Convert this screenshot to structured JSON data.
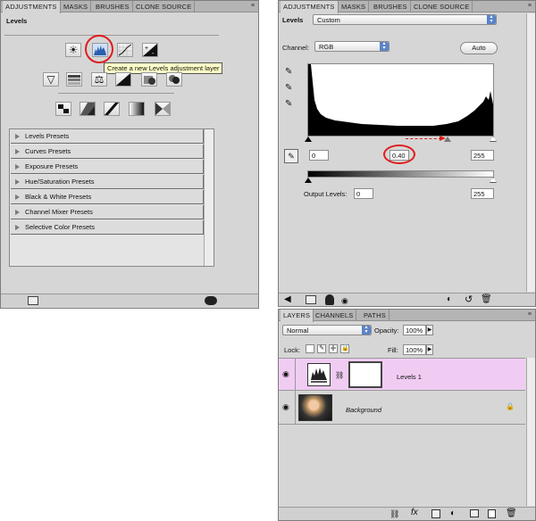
{
  "left_panel": {
    "tabs": [
      "ADJUSTMENTS",
      "MASKS",
      "BRUSHES",
      "CLONE SOURCE"
    ],
    "title": "Levels",
    "tooltip": "Create a new Levels adjustment layer",
    "presets": [
      "Levels Presets",
      "Curves Presets",
      "Exposure Presets",
      "Hue/Saturation Presets",
      "Black & White Presets",
      "Channel Mixer Presets",
      "Selective Color Presets"
    ],
    "icons": [
      "brightness-icon",
      "levels-icon",
      "curves-icon",
      "exposure-icon",
      "vibrance-icon",
      "hue-saturation-icon",
      "color-balance-icon",
      "black-white-icon",
      "photo-filter-icon",
      "channel-mixer-icon",
      "invert-icon",
      "posterize-icon",
      "threshold-icon",
      "gradient-map-icon",
      "selective-color-icon"
    ]
  },
  "levels_panel": {
    "tabs": [
      "ADJUSTMENTS",
      "MASKS",
      "BRUSHES",
      "CLONE SOURCE"
    ],
    "title": "Levels",
    "preset_value": "Custom",
    "channel_label": "Channel:",
    "channel_value": "RGB",
    "auto_label": "Auto",
    "input_black": "0",
    "input_gamma": "0.40",
    "input_white": "255",
    "output_label": "Output Levels:",
    "output_black": "0",
    "output_white": "255"
  },
  "layers_panel": {
    "tabs": [
      "LAYERS",
      "CHANNELS",
      "PATHS"
    ],
    "blend_mode": "Normal",
    "opacity_label": "Opacity:",
    "opacity_value": "100%",
    "lock_label": "Lock:",
    "fill_label": "Fill:",
    "fill_value": "100%",
    "layers": [
      {
        "name": "Levels 1"
      },
      {
        "name": "Background"
      }
    ]
  },
  "colors": {
    "panel_bg": "#d6d6d6",
    "selected_layer": "#f0ccf3",
    "highlight_red": "#e01b1b"
  }
}
